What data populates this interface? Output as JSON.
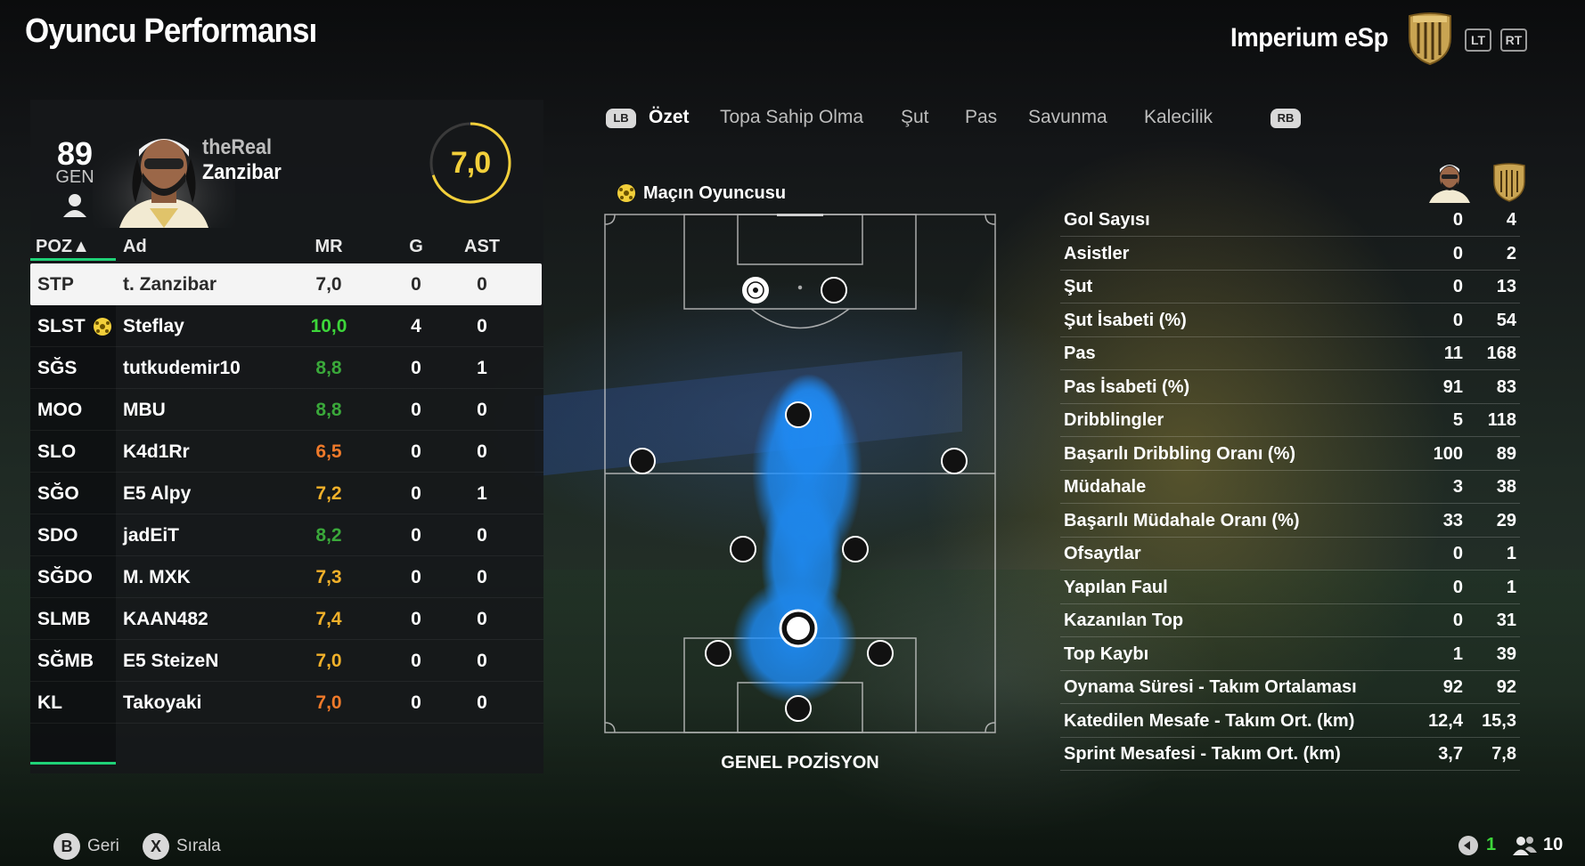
{
  "header": {
    "title": "Oyuncu Performansı",
    "club_name": "Imperium eSp",
    "lt": "LT",
    "rt": "RT"
  },
  "player": {
    "gen_value": "89",
    "gen_label": "GEN",
    "name_line1": "theReal",
    "name_line2": "Zanzibar",
    "rating": "7,0"
  },
  "table": {
    "headers": {
      "pos": "POZ▲",
      "name": "Ad",
      "mr": "MR",
      "g": "G",
      "ast": "AST"
    },
    "rows": [
      {
        "pos": "STP",
        "name": "t. Zanzibar",
        "mr": "7,0",
        "g": "0",
        "ast": "0",
        "color": "#2a2a2a"
      },
      {
        "pos": "SLST",
        "name": "Steflay",
        "mr": "10,0",
        "g": "4",
        "ast": "0",
        "color": "#3dd63a"
      },
      {
        "pos": "SĞS",
        "name": "tutkudemir10",
        "mr": "8,8",
        "g": "0",
        "ast": "1",
        "color": "#3aa83a"
      },
      {
        "pos": "MOO",
        "name": "MBU",
        "mr": "8,8",
        "g": "0",
        "ast": "0",
        "color": "#3aa83a"
      },
      {
        "pos": "SLO",
        "name": "K4d1Rr",
        "mr": "6,5",
        "g": "0",
        "ast": "0",
        "color": "#f07a2a"
      },
      {
        "pos": "SĞO",
        "name": "E5 Alpy",
        "mr": "7,2",
        "g": "0",
        "ast": "1",
        "color": "#f2b12a"
      },
      {
        "pos": "SDO",
        "name": "jadEiT",
        "mr": "8,2",
        "g": "0",
        "ast": "0",
        "color": "#3aa83a"
      },
      {
        "pos": "SĞDO",
        "name": "M. MXK",
        "mr": "7,3",
        "g": "0",
        "ast": "0",
        "color": "#f2b12a"
      },
      {
        "pos": "SLMB",
        "name": "KAAN482",
        "mr": "7,4",
        "g": "0",
        "ast": "0",
        "color": "#f2b12a"
      },
      {
        "pos": "SĞMB",
        "name": "E5 SteizeN",
        "mr": "7,0",
        "g": "0",
        "ast": "0",
        "color": "#f2b12a"
      },
      {
        "pos": "KL",
        "name": "Takoyaki",
        "mr": "7,0",
        "g": "0",
        "ast": "0",
        "color": "#f07a2a"
      }
    ]
  },
  "tabs": {
    "lb": "LB",
    "rb": "RB",
    "items": [
      "Özet",
      "Topa Sahip Olma",
      "Şut",
      "Pas",
      "Savunma",
      "Kalecilik"
    ]
  },
  "pitch": {
    "motm_label": "Maçın Oyuncusu",
    "caption": "GENEL POZİSYON"
  },
  "stats": [
    {
      "label": "Gol Sayısı",
      "player": "0",
      "team": "4"
    },
    {
      "label": "Asistler",
      "player": "0",
      "team": "2"
    },
    {
      "label": "Şut",
      "player": "0",
      "team": "13"
    },
    {
      "label": "Şut İsabeti (%)",
      "player": "0",
      "team": "54"
    },
    {
      "label": "Pas",
      "player": "11",
      "team": "168"
    },
    {
      "label": "Pas İsabeti (%)",
      "player": "91",
      "team": "83"
    },
    {
      "label": "Dribblingler",
      "player": "5",
      "team": "118"
    },
    {
      "label": "Başarılı Dribbling Oranı (%)",
      "player": "100",
      "team": "89"
    },
    {
      "label": "Müdahale",
      "player": "3",
      "team": "38"
    },
    {
      "label": "Başarılı Müdahale Oranı (%)",
      "player": "33",
      "team": "29"
    },
    {
      "label": "Ofsaytlar",
      "player": "0",
      "team": "1"
    },
    {
      "label": "Yapılan Faul",
      "player": "0",
      "team": "1"
    },
    {
      "label": "Kazanılan Top",
      "player": "0",
      "team": "31"
    },
    {
      "label": "Top Kaybı",
      "player": "1",
      "team": "39"
    },
    {
      "label": "Oynama Süresi - Takım Ortalaması",
      "player": "92",
      "team": "92"
    },
    {
      "label": "Katedilen Mesafe - Takım Ort. (km)",
      "player": "12,4",
      "team": "15,3"
    },
    {
      "label": "Sprint Mesafesi - Takım Ort. (km)",
      "player": "3,7",
      "team": "7,8"
    }
  ],
  "footer": {
    "back_btn": "B",
    "back_label": "Geri",
    "sort_btn": "X",
    "sort_label": "Sırala",
    "mic_count": "1",
    "party_count": "10"
  },
  "colors": {
    "accent_green": "#1fd177",
    "rating_yellow": "#f2cf3a",
    "heatmap_blue": "#1e90ff"
  }
}
